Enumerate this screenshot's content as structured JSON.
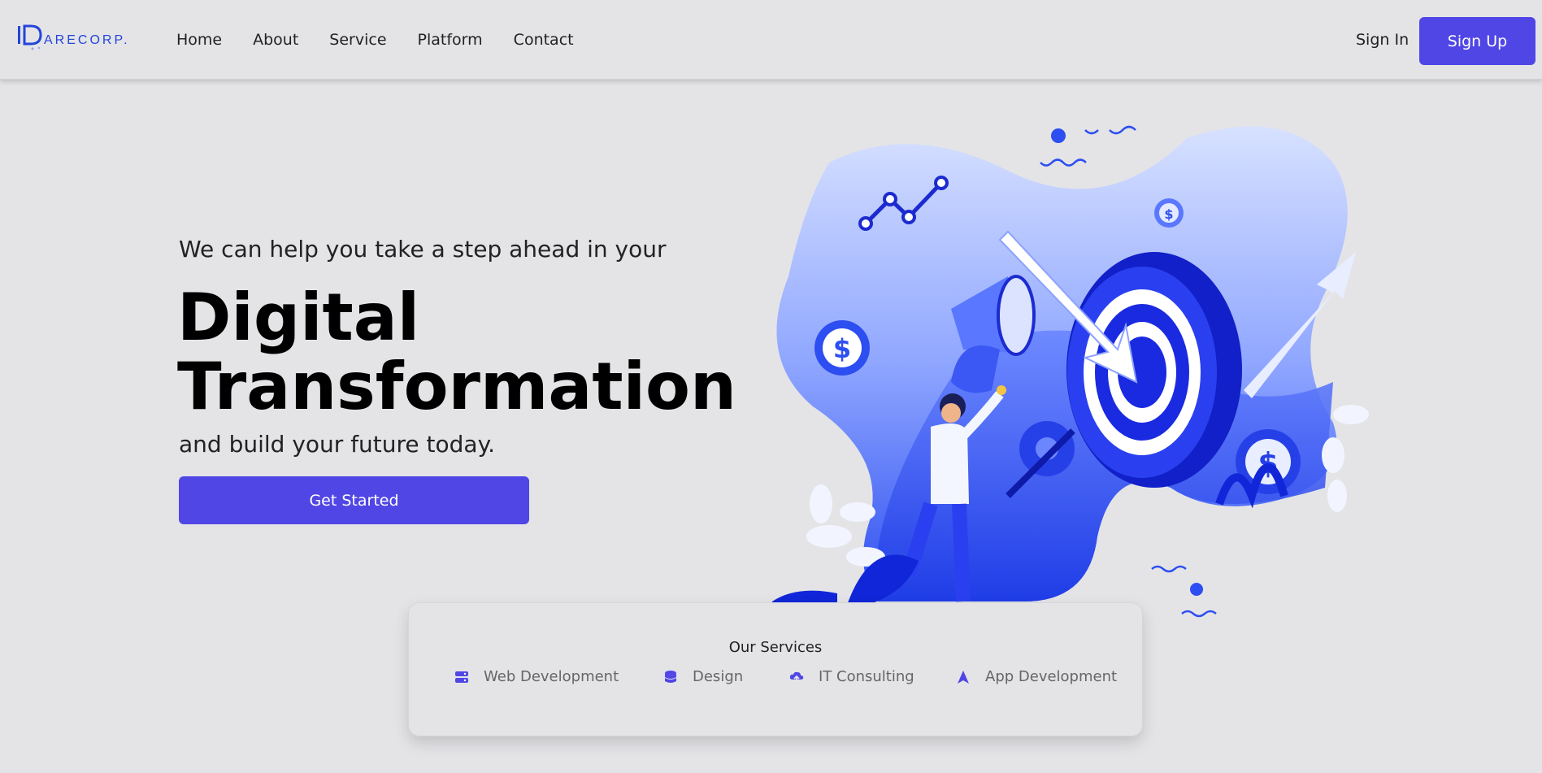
{
  "brand": {
    "logo_text": "ARECORP.",
    "accent_color": "#5046e5",
    "logo_color": "#2445d8"
  },
  "nav": {
    "links": [
      {
        "label": "Home"
      },
      {
        "label": "About"
      },
      {
        "label": "Service"
      },
      {
        "label": "Platform"
      },
      {
        "label": "Contact"
      }
    ],
    "sign_in": "Sign In",
    "sign_up": "Sign Up"
  },
  "hero": {
    "subtitle": "We can help you take a step ahead in your",
    "title_line1": "Digital",
    "title_line2": "Transformation",
    "tagline": "and build your future today.",
    "cta_label": "Get Started",
    "illustration_icon": "target-arrow-illustration"
  },
  "services": {
    "title": "Our Services",
    "items": [
      {
        "label": "Web Development",
        "icon": "server-icon"
      },
      {
        "label": "Design",
        "icon": "database-icon"
      },
      {
        "label": "IT Consulting",
        "icon": "cloud-upload-icon"
      },
      {
        "label": "App Development",
        "icon": "rocket-icon"
      }
    ]
  }
}
